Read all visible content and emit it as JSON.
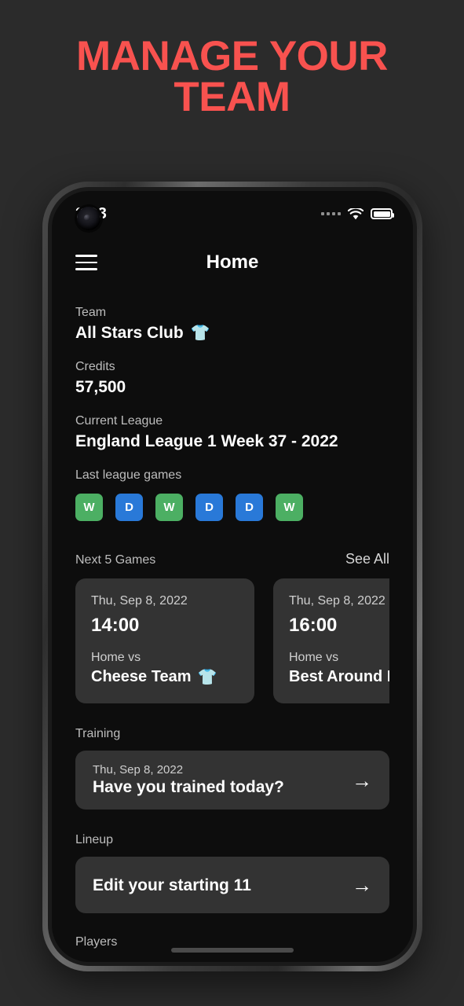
{
  "promo": {
    "headline_line1": "MANAGE YOUR",
    "headline_line2": "TEAM",
    "accent_color": "#f8524f",
    "background_color": "#2b2b2b"
  },
  "status_bar": {
    "time": "2.33",
    "signal_icon": "signal-dots-icon",
    "wifi_icon": "wifi-icon",
    "battery_icon": "battery-full-icon"
  },
  "app_bar": {
    "menu_icon": "hamburger-menu-icon",
    "title": "Home"
  },
  "team": {
    "label": "Team",
    "name": "All Stars Club",
    "shirt_icon": "tshirt-icon",
    "shirt_color": "#1414ff"
  },
  "credits": {
    "label": "Credits",
    "value": "57,500"
  },
  "league": {
    "label": "Current League",
    "value": "England League 1 Week 37 - 2022"
  },
  "form": {
    "label": "Last league games",
    "results": [
      "W",
      "D",
      "W",
      "D",
      "D",
      "W"
    ],
    "win_color": "#4caf63",
    "draw_color": "#2979d8"
  },
  "next_games": {
    "label": "Next 5 Games",
    "see_all_label": "See All",
    "cards": [
      {
        "date": "Thu, Sep 8, 2022",
        "time": "14:00",
        "side": "Home vs",
        "opponent": "Cheese Team",
        "shirt_icon": "tshirt-icon",
        "shirt_color": "#18e018"
      },
      {
        "date": "Thu, Sep 8, 2022",
        "time": "16:00",
        "side": "Home vs",
        "opponent": "Best Around F",
        "shirt_icon": "tshirt-icon",
        "shirt_color": "#18e018"
      }
    ]
  },
  "training": {
    "label": "Training",
    "date": "Thu, Sep 8, 2022",
    "prompt": "Have you trained today?",
    "arrow_icon": "arrow-right-icon"
  },
  "lineup": {
    "label": "Lineup",
    "action": "Edit your starting 11",
    "arrow_icon": "arrow-right-icon"
  },
  "players": {
    "label": "Players"
  }
}
